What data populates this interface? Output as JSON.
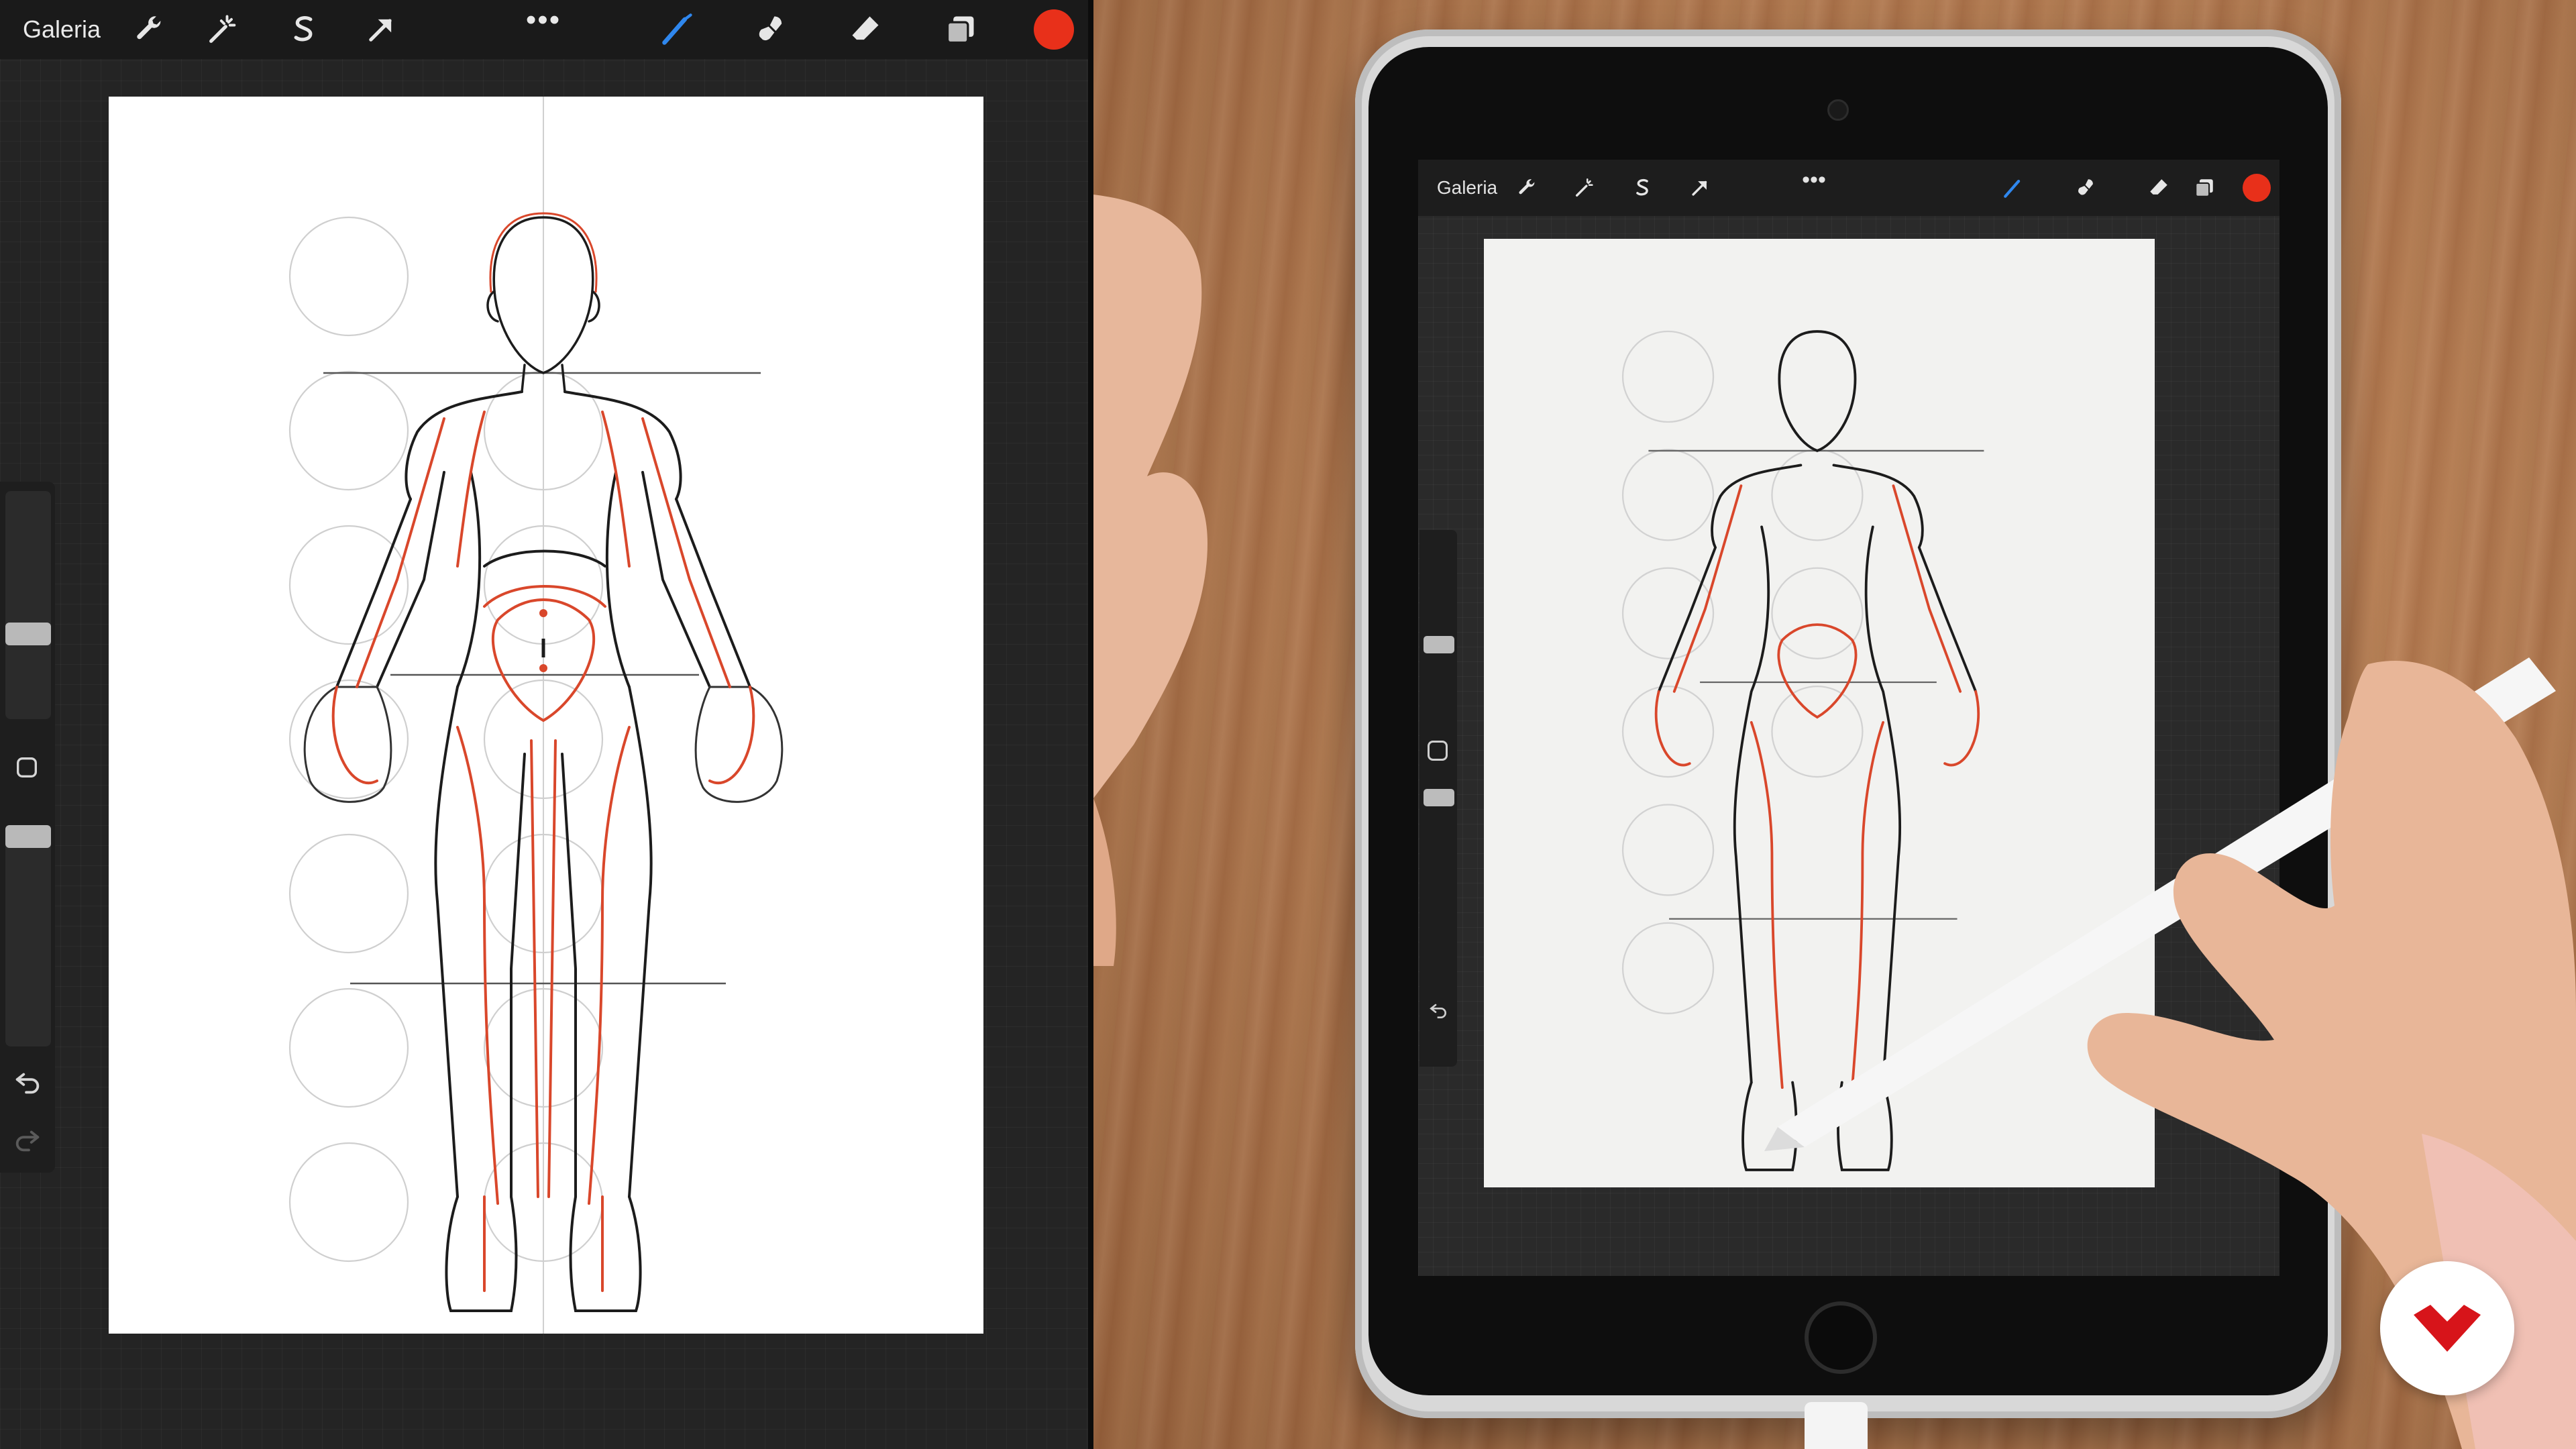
{
  "toolbar": {
    "gallery_label": "Galeria",
    "more_label": "•••",
    "active_color": "#e8301a",
    "icons": [
      "wrench-icon",
      "magic-wand-icon",
      "selection-s-icon",
      "transform-arrow-icon",
      "brush-icon",
      "smudge-icon",
      "eraser-icon",
      "layers-icon"
    ]
  },
  "tablet_toolbar": {
    "gallery_label": "Galeria",
    "more_label": "•••"
  },
  "colors": {
    "sketch_red": "#d9472b",
    "sketch_black": "#1c1c1c",
    "guide_gray": "#c9c9c9",
    "brand_red": "#d7141a"
  }
}
